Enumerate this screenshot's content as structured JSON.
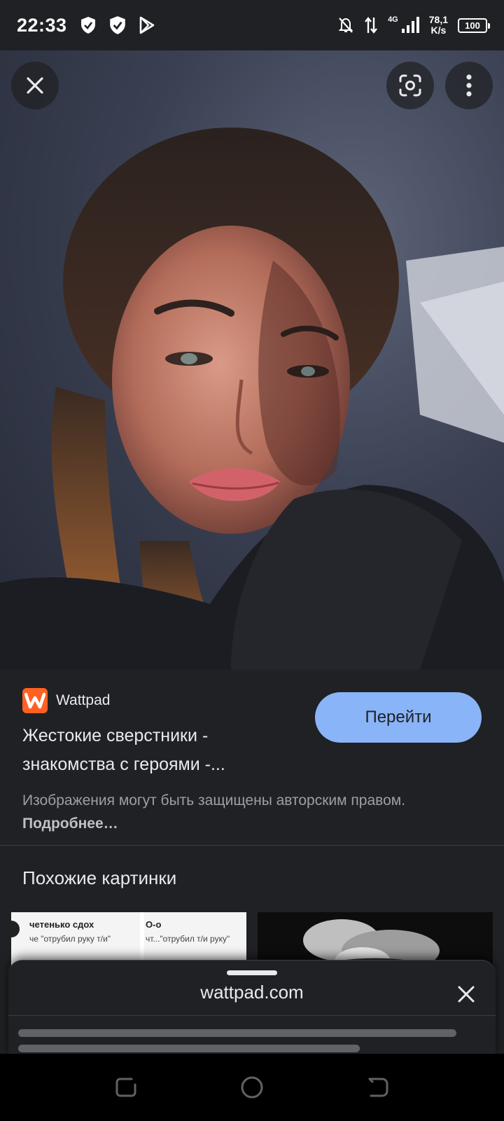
{
  "status_bar": {
    "time": "22:33",
    "network_type": "4G",
    "speed_value": "78,1",
    "speed_unit": "K/s",
    "battery": "100",
    "icons": [
      "shield-check-icon",
      "shield-check-icon",
      "play-store-icon",
      "bell-off-icon",
      "data-transfer-icon",
      "signal-icon",
      "battery-icon"
    ]
  },
  "viewer": {
    "close_icon": "close-icon",
    "lens_icon": "google-lens-icon",
    "more_icon": "more-vert-icon"
  },
  "result": {
    "source_name": "Wattpad",
    "source_logo_letter": "W",
    "title_line1": "Жестокие сверстники -",
    "title_line2": "знакомства с героями -...",
    "goto_label": "Перейти",
    "copyright_text": "Изображения могут быть защищены авторским правом.",
    "copyright_link": "Подробнее…"
  },
  "similar": {
    "heading": "Похожие картинки",
    "thumb1": {
      "col1_name": "четенько сдох",
      "col1_msg": "че \"отрубил руку т/и\"",
      "col2_name": "О-о",
      "col2_msg": "чт...\"отрубил т/и руку\""
    }
  },
  "sheet": {
    "domain": "wattpad.com"
  },
  "colors": {
    "background": "#202124",
    "accent_button": "#8ab4f8",
    "wattpad_brand": "#ff6122",
    "muted_text": "#9aa0a6"
  }
}
